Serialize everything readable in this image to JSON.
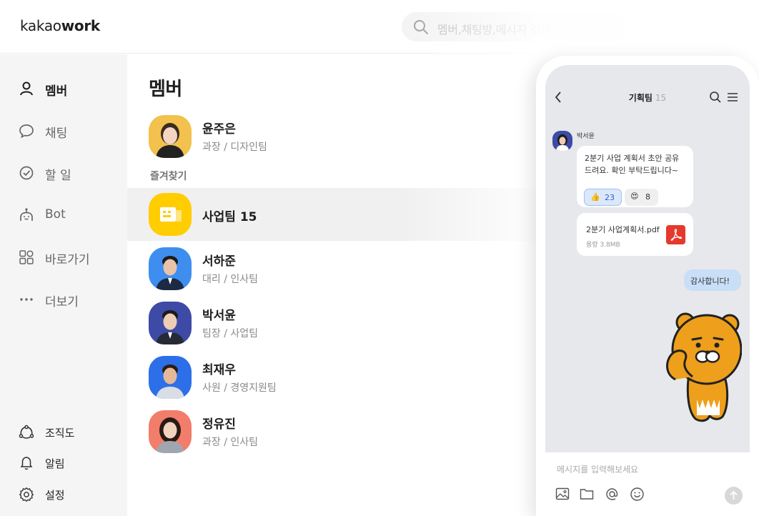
{
  "header": {
    "logo_part1": "kakao",
    "logo_part2": "work",
    "search_placeholder": "멤버,채팅방,메시지 검색"
  },
  "sidebar": {
    "items": [
      {
        "label": "멤버",
        "icon": "person-icon",
        "active": true
      },
      {
        "label": "채팅",
        "icon": "chat-bubble-icon"
      },
      {
        "label": "할 일",
        "icon": "check-circle-icon"
      },
      {
        "label": "Bot",
        "icon": "bot-icon"
      },
      {
        "label": "바로가기",
        "icon": "shortcut-grid-icon"
      },
      {
        "label": "더보기",
        "icon": "more-dots-icon"
      }
    ],
    "bottom_items": [
      {
        "label": "조직도",
        "icon": "org-chart-icon"
      },
      {
        "label": "알림",
        "icon": "bell-icon"
      },
      {
        "label": "설정",
        "icon": "gear-icon"
      }
    ]
  },
  "main": {
    "title": "멤버",
    "me": {
      "name": "윤주은",
      "sub": "과장 / 디자인팀"
    },
    "favorites_label": "즐겨찾기",
    "rows": [
      {
        "name": "사업팀 15",
        "sub": "",
        "avatar_color": "#ffcd00",
        "selected": true
      },
      {
        "name": "서하준",
        "sub": "대리 / 인사팀",
        "avatar_color": "#3e8ef0"
      },
      {
        "name": "박서윤",
        "sub": "팀장 / 사업팀",
        "avatar_color": "#3d4aa6"
      },
      {
        "name": "최재우",
        "sub": "사원 / 경영지원팀",
        "avatar_color": "#2d6fe8"
      },
      {
        "name": "정유진",
        "sub": "과장 / 인사팀",
        "avatar_color": "#f27d6a"
      }
    ]
  },
  "chat": {
    "title": "기획팀",
    "count": "15",
    "sender": "박서윤",
    "message_line1": "2분기 사업 계획서 초안 공유",
    "message_line2": "드려요. 확인 부탁드립니다~",
    "reaction1_emoji": "👍",
    "reaction1_count": "23",
    "reaction2_emoji": "😍",
    "reaction2_count": "8",
    "file_name": "2분기 사업계획서.pdf",
    "file_size": "용량  3.8MB",
    "reply": "감사합니다!",
    "input_placeholder": "메시지를 입력해보세요"
  },
  "colors": {
    "accent_yellow": "#ffcd00",
    "sidebar_bg": "#f5f5f5",
    "chat_bg": "#e6e8ec",
    "my_bubble": "#c9def7",
    "pdf_red": "#e5392d"
  }
}
